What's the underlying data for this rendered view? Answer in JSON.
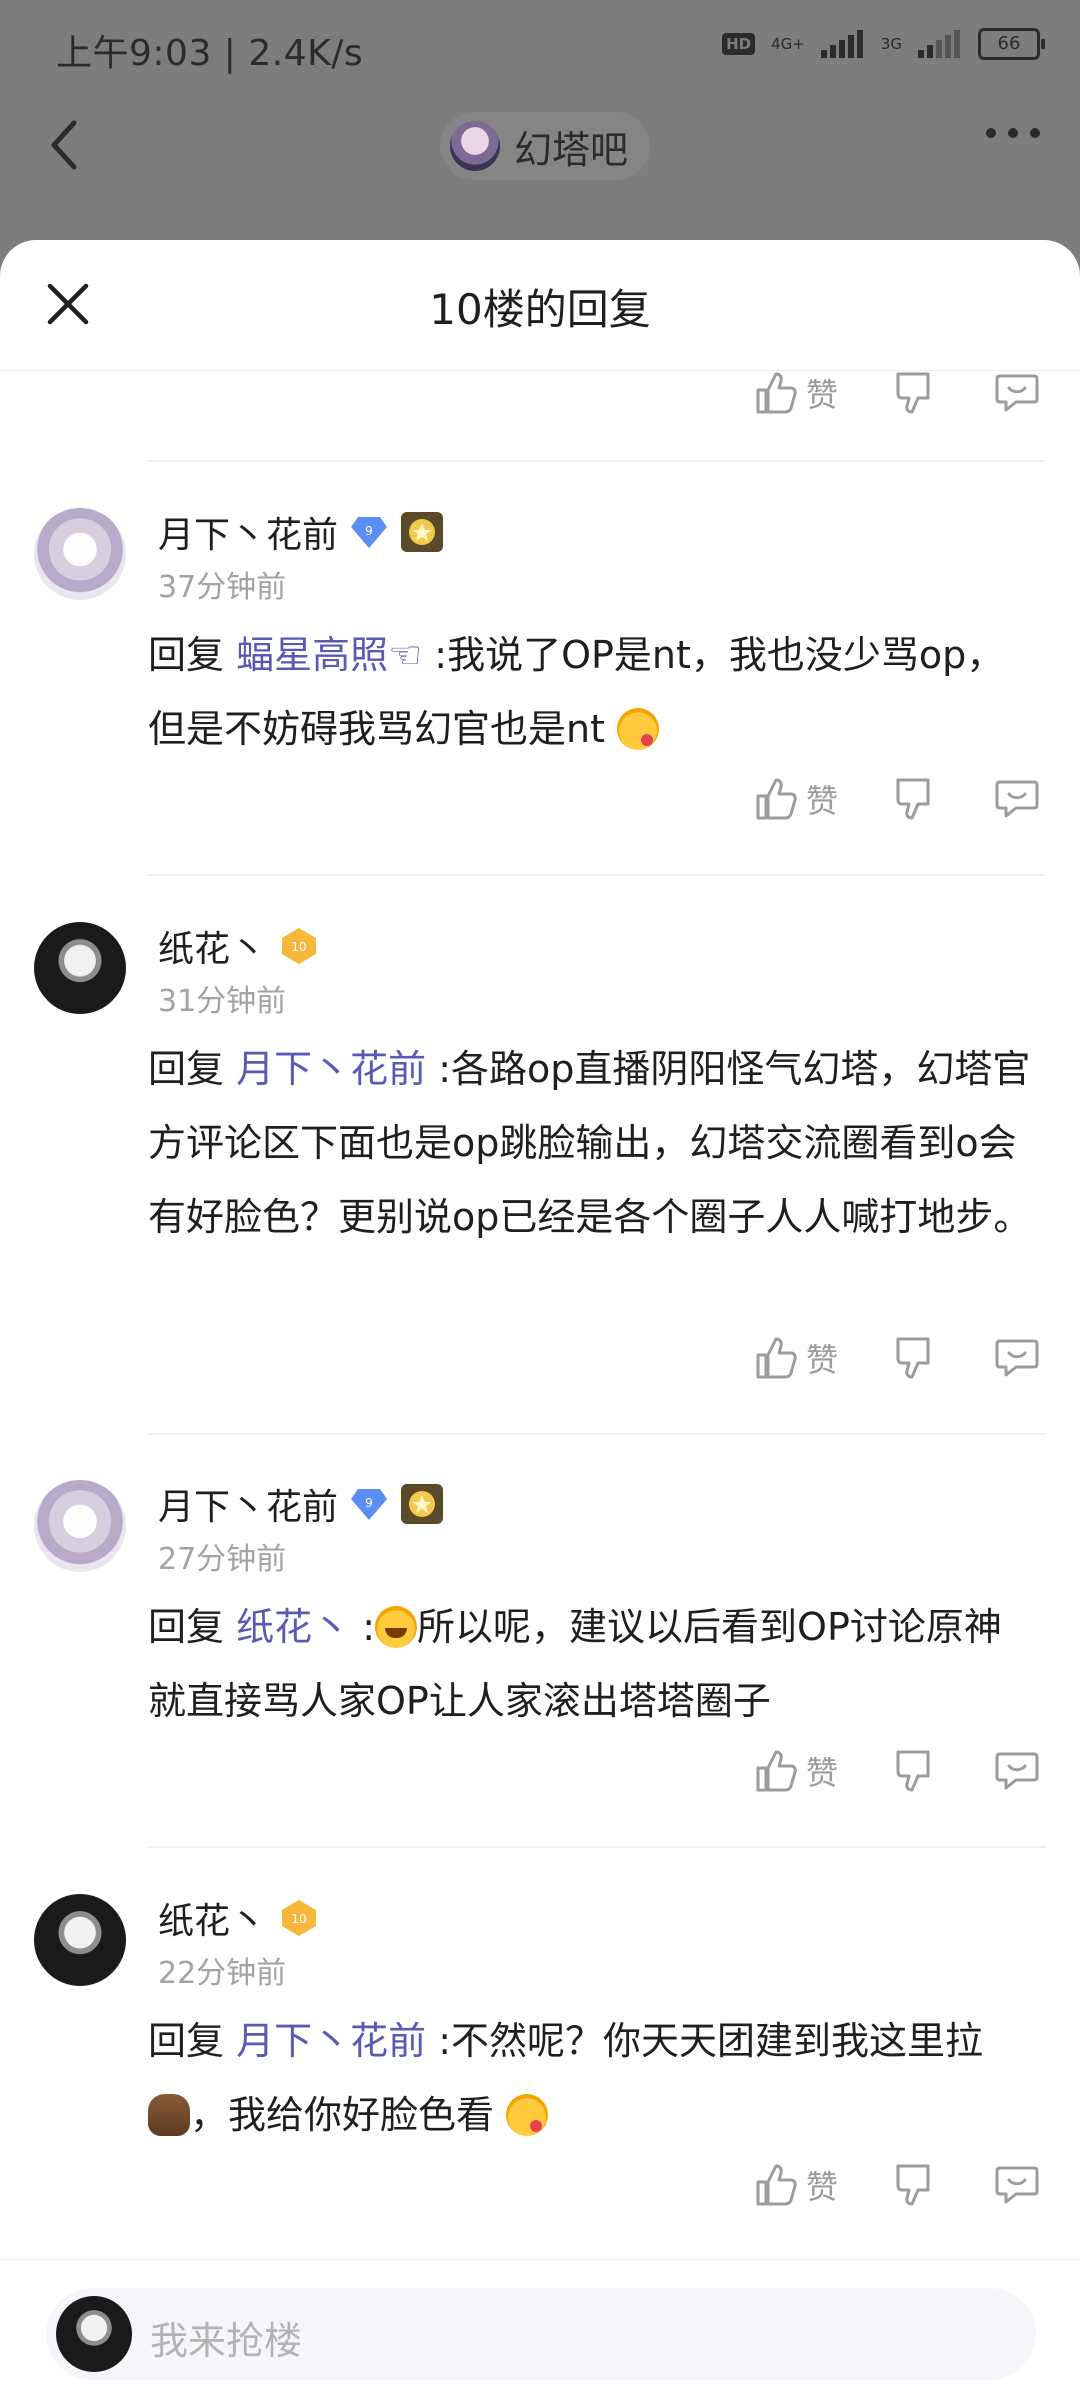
{
  "status_bar": {
    "time_speed": "上午9:03 | 2.4K/s",
    "hd": "HD",
    "net1": "4G+",
    "net2": "3G",
    "battery": "66"
  },
  "topbar": {
    "forum_name": "幻塔吧"
  },
  "sheet": {
    "title": "10楼的回复"
  },
  "action_labels": {
    "like": "赞"
  },
  "comments": [
    {
      "user": "月下丶花前",
      "level": "9",
      "time": "37分钟前",
      "reply_prefix": "回复",
      "mention": "蝠星高照☜",
      "text": ":我说了OP是nt，我也没少骂op，但是不妨碍我骂幻官也是nt"
    },
    {
      "user": "纸花丶",
      "level": "10",
      "time": "31分钟前",
      "reply_prefix": "回复",
      "mention": "月下丶花前",
      "text": ":各路op直播阴阳怪气幻塔，幻塔官方评论区下面也是op跳脸输出，幻塔交流圈看到o会有好脸色？更别说op已经是各个圈子人人喊打地步。"
    },
    {
      "user": "月下丶花前",
      "level": "9",
      "time": "27分钟前",
      "reply_prefix": "回复",
      "mention": "纸花丶",
      "text_before_emoji": ":",
      "text": "所以呢，建议以后看到OP讨论原神就直接骂人家OP让人家滚出塔塔圈子"
    },
    {
      "user": "纸花丶",
      "level": "10",
      "time": "22分钟前",
      "reply_prefix": "回复",
      "mention": "月下丶花前",
      "text": ":不然呢？你天天团建到我这里拉",
      "text_after_emoji": "，我给你好脸色看"
    }
  ],
  "bottom": {
    "placeholder": "我来抢楼"
  },
  "icons": [
    "back-icon",
    "more-icon",
    "close-icon",
    "like-icon",
    "dislike-icon",
    "reply-icon",
    "level-badge-icon",
    "medal-icon"
  ]
}
